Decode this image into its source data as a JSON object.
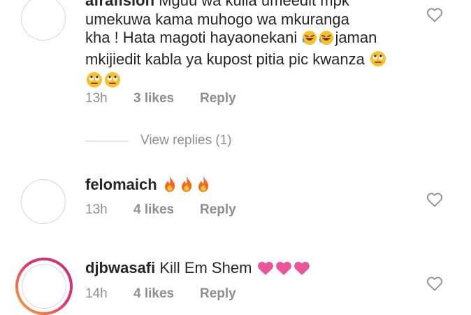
{
  "comments": [
    {
      "username": "afrafision",
      "text_line1": "Mguu wa kulia umeedit mpk",
      "text_line2": "umekuwa kama muhogo wa mkuranga",
      "text_line3_a": "kha ! Hata magoti hayaonekani",
      "text_line3_b": "jaman",
      "text_line4": "mkijiedit kabla ya kupost pitia pic kwanza",
      "emoji_rofl": "🤣",
      "emoji_eyeroll": "🙄",
      "time": "13h",
      "likes": "3 likes",
      "reply": "Reply"
    },
    {
      "username": "felomaich",
      "text": "",
      "emoji_fire": "🔥",
      "time": "13h",
      "likes": "4 likes",
      "reply": "Reply"
    },
    {
      "username": "djbwasafi",
      "text": "Kill Em Shem",
      "emoji_heart": "💗",
      "time": "14h",
      "likes": "4 likes",
      "reply": "Reply"
    }
  ],
  "view_replies": "View replies (1)",
  "icons": {
    "like": "heart-outline-icon"
  },
  "colors": {
    "text": "#262626",
    "muted": "#8e8e8e",
    "heart_emoji": "#e8559b",
    "fire_emoji": "#f46a1c"
  }
}
